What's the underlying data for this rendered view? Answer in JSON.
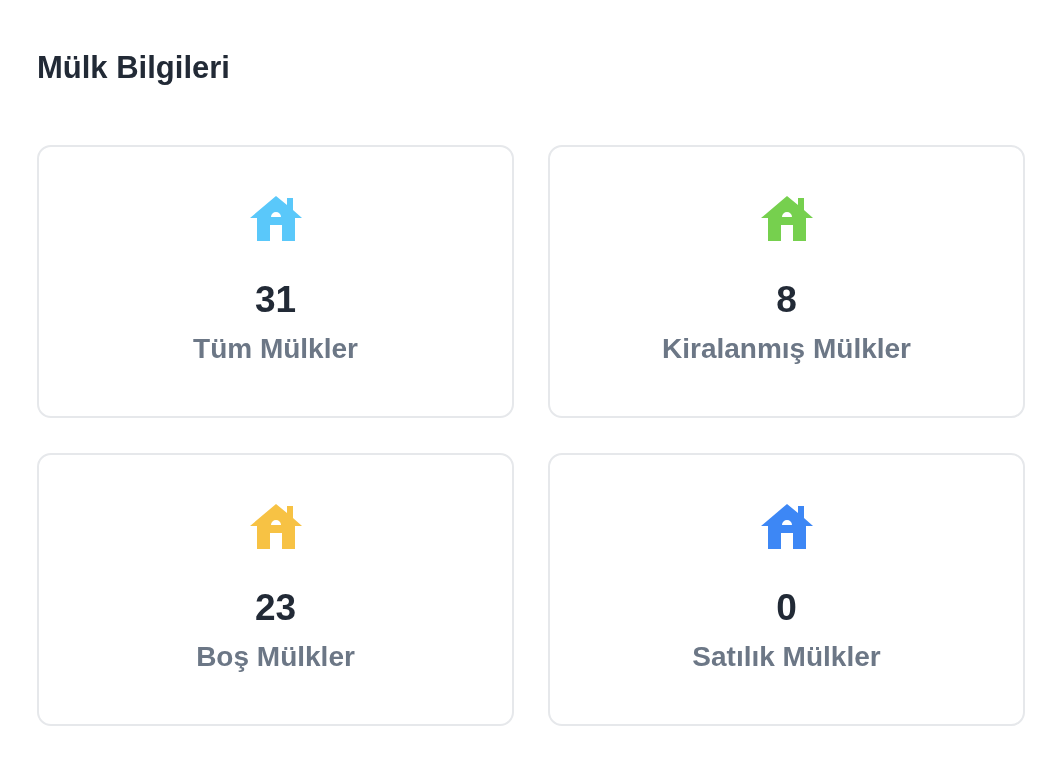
{
  "section": {
    "title": "Mülk Bilgileri"
  },
  "cards": [
    {
      "value": "31",
      "label": "Tüm Mülkler",
      "color": "#5ac8fa"
    },
    {
      "value": "8",
      "label": "Kiralanmış Mülkler",
      "color": "#76d04e"
    },
    {
      "value": "23",
      "label": "Boş Mülkler",
      "color": "#f7c244"
    },
    {
      "value": "0",
      "label": "Satılık Mülkler",
      "color": "#3d87f5"
    }
  ]
}
